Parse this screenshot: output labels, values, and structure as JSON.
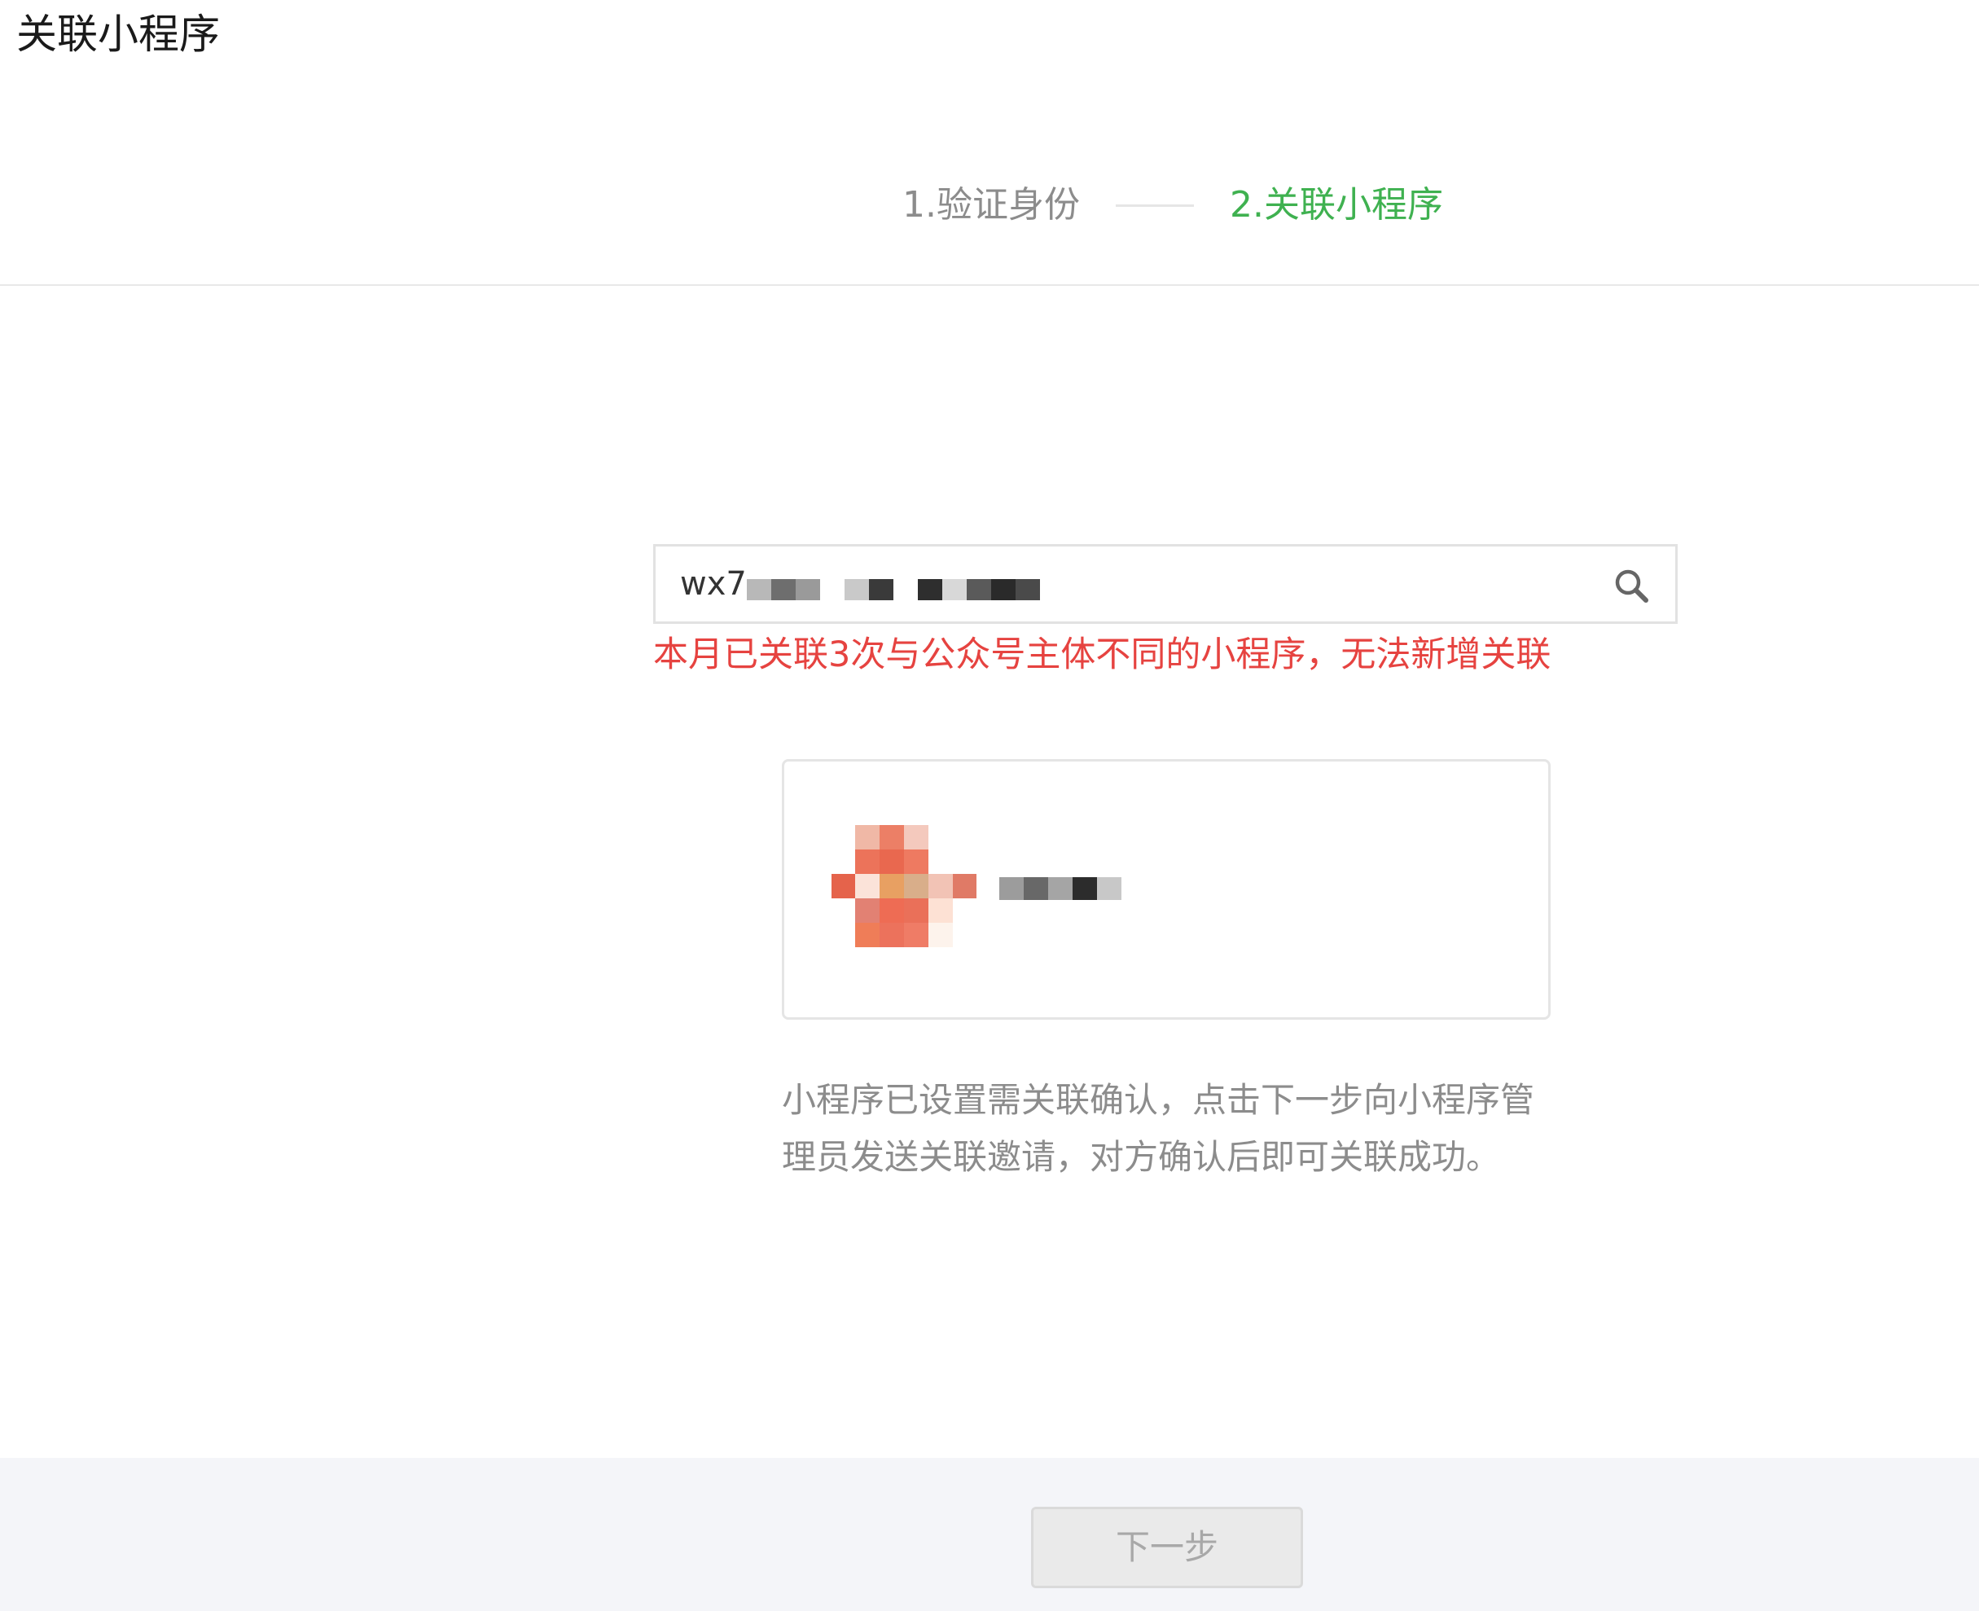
{
  "dialog": {
    "title": "关联小程序"
  },
  "steps": [
    {
      "label": "1.验证身份",
      "state": "done"
    },
    {
      "label": "2.关联小程序",
      "state": "active"
    }
  ],
  "search": {
    "value": "wx7"
  },
  "error": {
    "message": "本月已关联3次与公众号主体不同的小程序，无法新增关联"
  },
  "hint": {
    "text": "小程序已设置需关联确认，点击下一步向小程序管理员发送关联邀请，对方确认后即可关联成功。"
  },
  "footer": {
    "next_label": "下一步"
  },
  "colors": {
    "active_step": "#3fb150",
    "error": "#e64340",
    "muted_text": "#8c8c8c",
    "footer_bg": "#f4f5f9"
  },
  "icons": {
    "search": "search-icon"
  }
}
